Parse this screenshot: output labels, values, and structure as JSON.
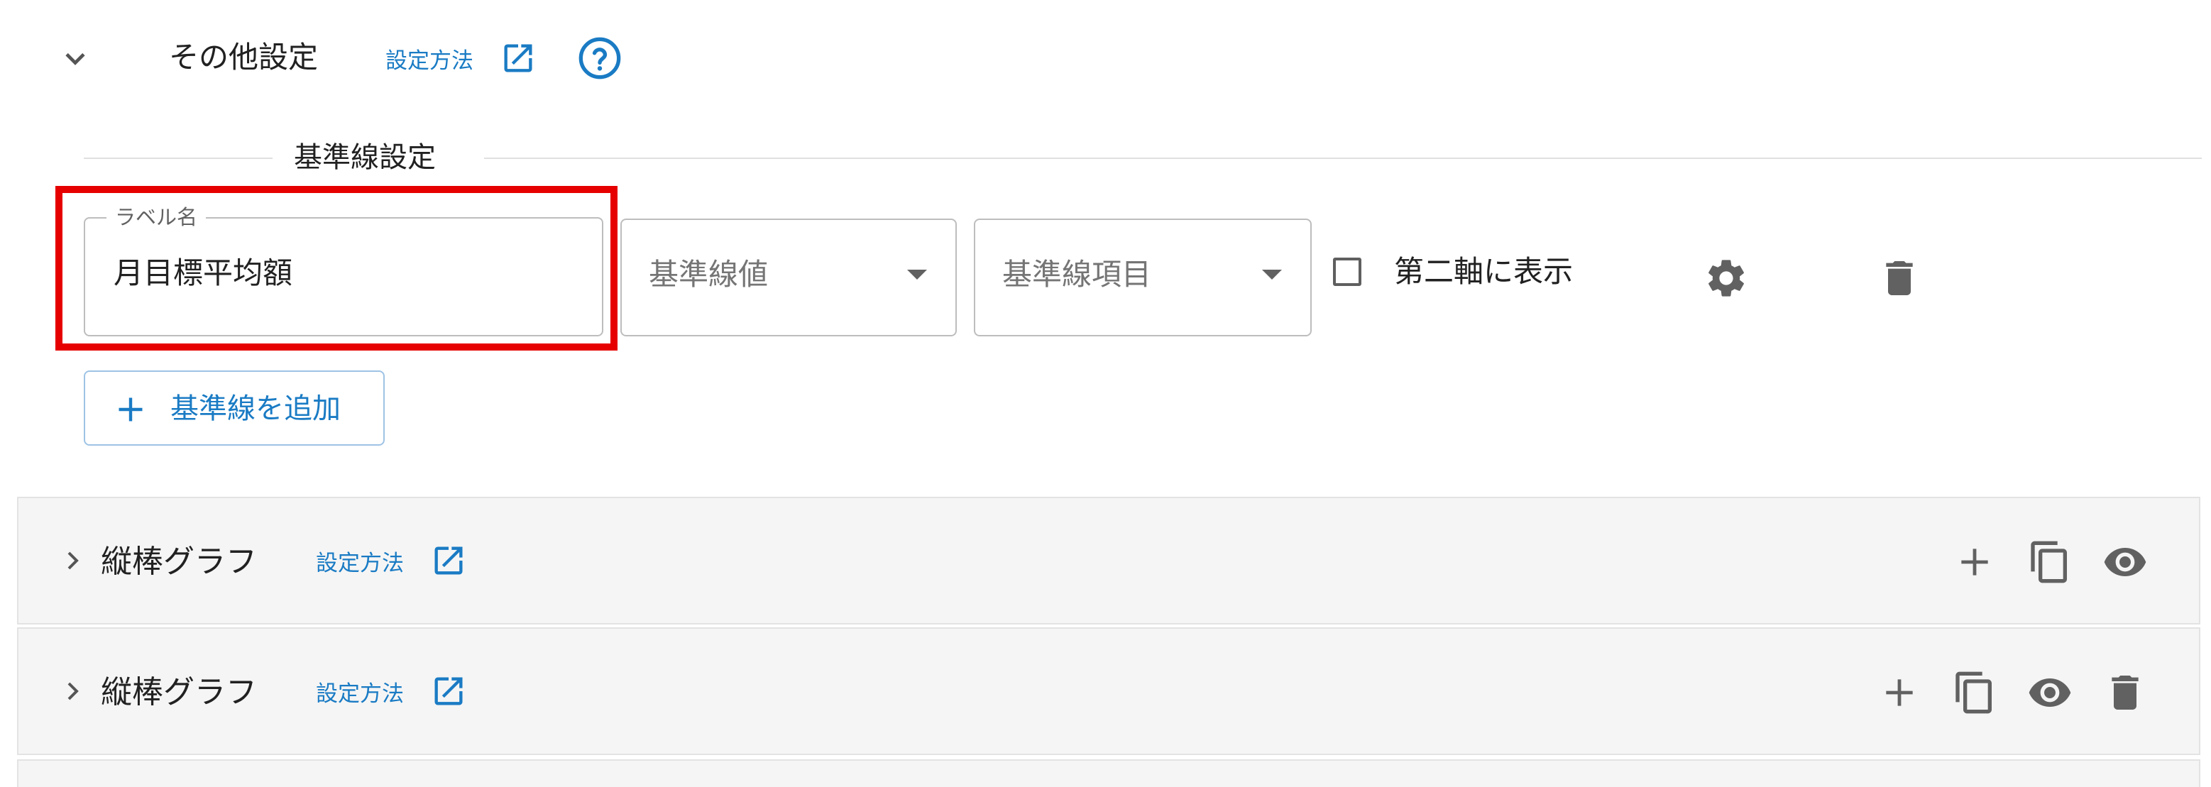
{
  "section": {
    "title": "その他設定",
    "how_to_link": "設定方法",
    "expand_icon": "chevron-down-icon",
    "external_icon": "open-in-new-icon",
    "help_icon": "help-circle-icon"
  },
  "baseline": {
    "legend": "基準線設定",
    "label_field": {
      "label": "ラベル名",
      "value": "月目標平均額"
    },
    "value_select": {
      "placeholder": "基準線値"
    },
    "item_select": {
      "placeholder": "基準線項目"
    },
    "secondary_axis": {
      "label": "第二軸に表示",
      "checked": false
    },
    "settings_icon": "gear-icon",
    "delete_icon": "trash-icon",
    "add_button": "基準線を追加"
  },
  "panels": [
    {
      "title": "縦棒グラフ",
      "how_to_link": "設定方法",
      "actions": [
        "plus-icon",
        "copy-icon",
        "eye-icon"
      ]
    },
    {
      "title": "縦棒グラフ",
      "how_to_link": "設定方法",
      "actions": [
        "plus-icon",
        "copy-icon",
        "eye-icon",
        "trash-icon"
      ]
    }
  ],
  "colors": {
    "accent": "#1a7bc4",
    "highlight": "#e60000",
    "panel_bg": "#f5f5f5",
    "border": "#bdbdbd",
    "icon": "#616161"
  }
}
